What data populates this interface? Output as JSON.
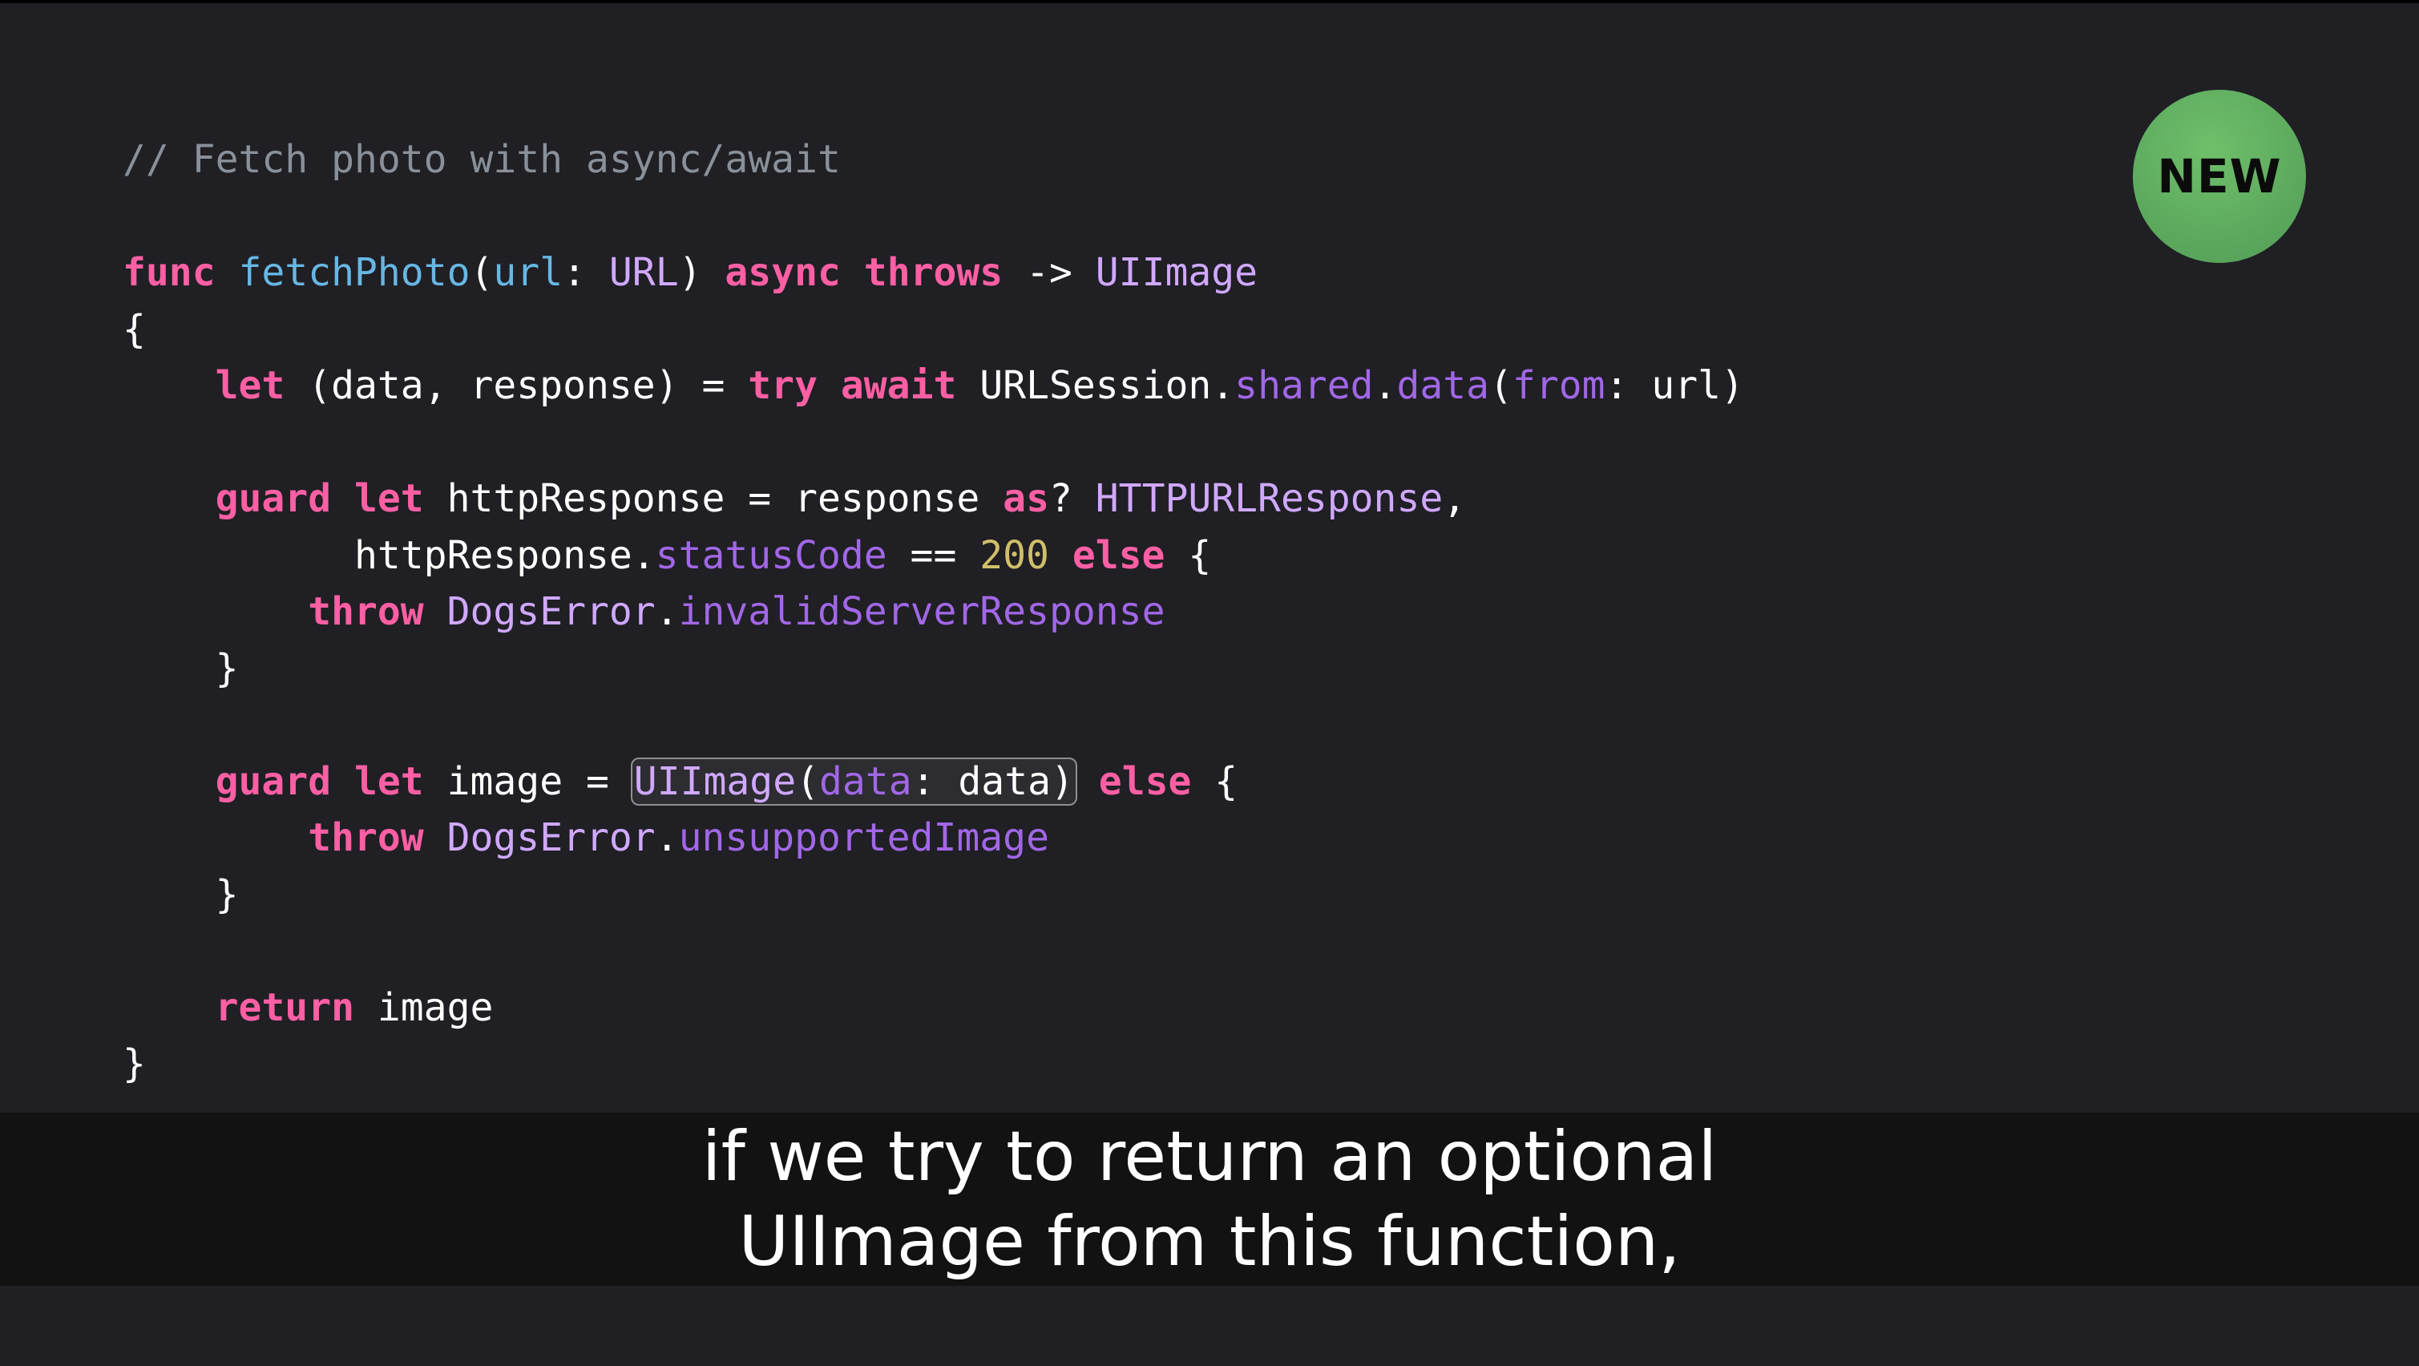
{
  "badge": {
    "label": "NEW",
    "color": "#5aa65c"
  },
  "code": {
    "comment": "// Fetch photo with async/await",
    "l1_func": "func",
    "l1_name": "fetchPhoto",
    "l1_open": "(",
    "l1_param": "url",
    "l1_colon": ": ",
    "l1_type": "URL",
    "l1_close": ") ",
    "l1_async": "async",
    "l1_throws": "throws",
    "l1_arrow": " -> ",
    "l1_ret": "UIImage",
    "l2_brace": "{",
    "l3_let": "let",
    "l3_tuple": " (data, response) = ",
    "l3_try": "try",
    "l3_await": "await",
    "l3_type": "URLSession",
    "l3_dot1": ".",
    "l3_shared": "shared",
    "l3_dot2": ".",
    "l3_data": "data",
    "l3_open": "(",
    "l3_from": "from",
    "l3_rest": ": url)",
    "l5_guard": "guard",
    "l5_let": "let",
    "l5_mid": " httpResponse = response ",
    "l5_as": "as",
    "l5_q": "? ",
    "l5_type": "HTTPURLResponse",
    "l5_comma": ",",
    "l6_obj": "httpResponse.",
    "l6_prop": "statusCode",
    "l6_eq": " == ",
    "l6_num": "200",
    "l6_else": "else",
    "l6_brace": " {",
    "l7_throw": "throw",
    "l7_type": "DogsError",
    "l7_dot": ".",
    "l7_case": "invalidServerResponse",
    "l8_brace": "}",
    "l10_guard": "guard",
    "l10_let": "let",
    "l10_mid": " image = ",
    "l10_type": "UIImage",
    "l10_open": "(",
    "l10_label": "data",
    "l10_rest": ": data)",
    "l10_else": "else",
    "l10_brace": " {",
    "l11_throw": "throw",
    "l11_type": "DogsError",
    "l11_dot": ".",
    "l11_case": "unsupportedImage",
    "l12_brace": "}",
    "l14_return": "return",
    "l14_val": " image",
    "l15_brace": "}"
  },
  "captions": {
    "line1": "if we try to return an optional",
    "line2": "UIImage from this function,"
  }
}
